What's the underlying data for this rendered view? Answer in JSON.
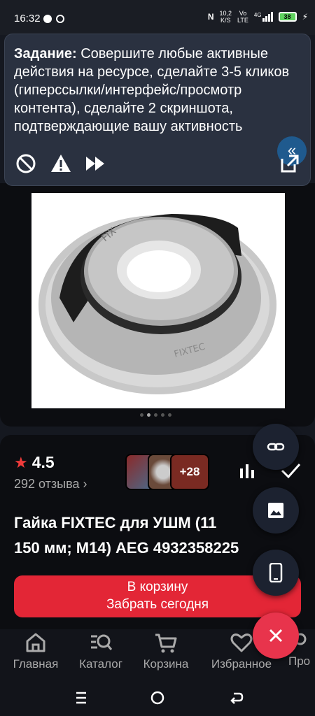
{
  "status": {
    "time": "16:32",
    "net_speed": "10,2",
    "net_unit": "K/S",
    "vo": "Vo",
    "lte": "LTE",
    "sig": "4G",
    "battery": "38"
  },
  "task": {
    "label": "Задание:",
    "text": " Совершите любые активные действия на ресурсе, сделайте 3-5 кликов (гиперссылки/интерфейс/просмотр контента), сделайте 2 скриншота, подтверждающие вашу активность"
  },
  "product": {
    "rating": "4.5",
    "reviews": "292 отзыва",
    "more_photos": "+28",
    "title_line1": "Гайка FIXTEC для УШМ (11",
    "title_line2": "150 мм; М14) AEG 4932358225",
    "cart_button": "В корзину",
    "cart_sub": "Забрать сегодня"
  },
  "nav": {
    "items": [
      "Главная",
      "Каталог",
      "Корзина",
      "Избранное",
      "Про"
    ]
  },
  "colors": {
    "accent": "#e32636",
    "fab_close": "#e8344c",
    "task_bg": "#2a3140"
  }
}
